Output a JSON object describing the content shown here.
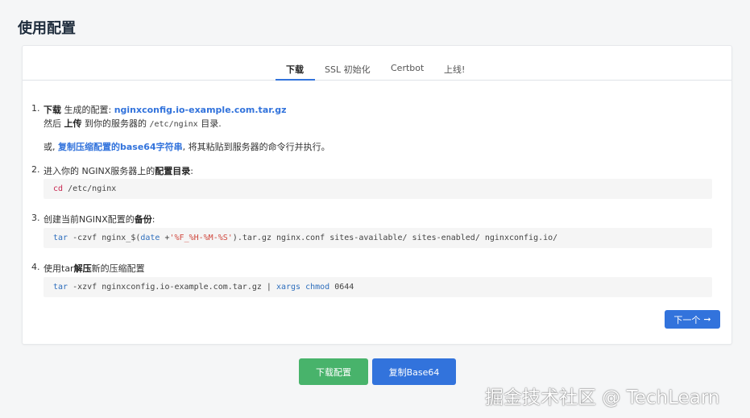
{
  "page": {
    "title": "使用配置"
  },
  "tabs": [
    {
      "label": "下载",
      "active": true
    },
    {
      "label": "SSL 初始化",
      "active": false
    },
    {
      "label": "Certbot",
      "active": false
    },
    {
      "label": "上线!",
      "active": false
    }
  ],
  "steps": {
    "s1": {
      "num": "1.",
      "download_bold": "下载",
      "text_a": " 生成的配置: ",
      "file_link": "nginxconfig.io-example.com.tar.gz",
      "then": "然后 ",
      "upload_bold": "上传",
      "text_b": " 到你的服务器的 ",
      "path": "/etc/nginx",
      "text_c": " 目录.",
      "or": "或, ",
      "copy_link": "复制压缩配置的base64字符串",
      "text_d": ", 将其粘贴到服务器的命令行并执行。"
    },
    "s2": {
      "num": "2.",
      "text": "进入你的 NGINX服务器上的",
      "bold": "配置目录",
      "colon": ":",
      "code_cmd": "cd",
      "code_rest": " /etc/nginx"
    },
    "s3": {
      "num": "3.",
      "text": "创建当前NGINX配置的",
      "bold": "备份",
      "colon": ":",
      "code_cmd": "tar",
      "code_a": " -czvf nginx_$(",
      "code_date": "date",
      "code_b": " +",
      "code_str": "'%F_%H-%M-%S'",
      "code_c": ").tar.gz nginx.conf sites-available/ sites-enabled/ nginxconfig.io/"
    },
    "s4": {
      "num": "4.",
      "text_a": "使用tar",
      "bold": "解压",
      "text_b": "新的压缩配置",
      "code_cmd": "tar",
      "code_a": " -xzvf nginxconfig.io-example.com.tar.gz | ",
      "code_xargs": "xargs",
      "code_b": " ",
      "code_chmod": "chmod",
      "code_c": " 0644"
    }
  },
  "buttons": {
    "next_label": "下一个",
    "next_icon": "arrow-right-icon",
    "download_config": "下载配置",
    "copy_base64": "复制Base64"
  },
  "colors": {
    "accent": "#3273dc",
    "green": "#48b36b"
  },
  "watermark": "掘金技术社区 @ TechLearn"
}
